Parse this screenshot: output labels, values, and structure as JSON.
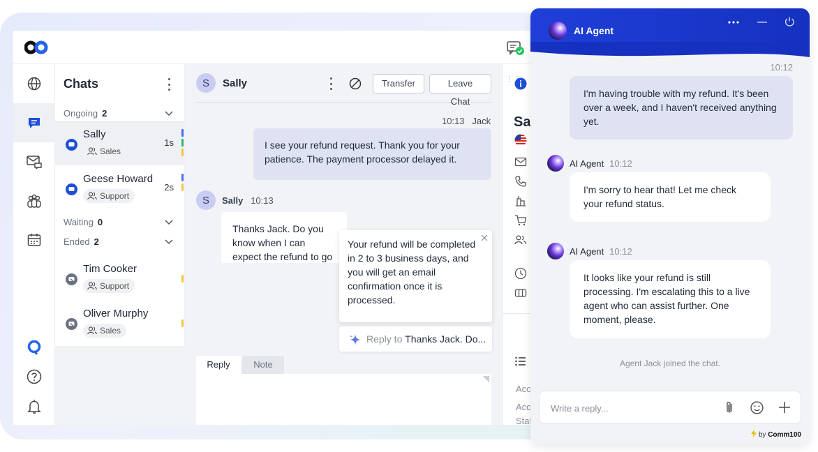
{
  "app": {
    "conversation": {
      "contact_name": "Sally",
      "contact_initial": "S",
      "transfer_label": "Transfer",
      "leave_label": "Leave Chat",
      "messages": [
        {
          "time": "10:13",
          "author": "Jack",
          "text": "I see your refund request. Thank you for your patience. The payment processor delayed it."
        },
        {
          "author": "Sally",
          "time": "10:13",
          "text": "Thanks Jack. Do you know when I can expect the refund to go th"
        }
      ],
      "suggestion": {
        "text": "Your refund will be completed in 2 to 3 business days, and you will get an email confirmation once it is processed.",
        "reply_prefix": "Reply to",
        "reply_quote": "Thanks Jack. Do..."
      },
      "tabs": [
        "Reply",
        "Note"
      ],
      "active_tab": "Reply"
    },
    "chats_panel": {
      "title": "Chats",
      "groups": {
        "ongoing": {
          "label": "Ongoing",
          "count": "2"
        },
        "waiting": {
          "label": "Waiting",
          "count": "0"
        },
        "ended": {
          "label": "Ended",
          "count": "2"
        }
      },
      "ongoing_items": [
        {
          "name": "Sally",
          "tag": "Sales",
          "time": "1s"
        },
        {
          "name": "Geese Howard",
          "tag": "Support",
          "time": "2s"
        }
      ],
      "ended_items": [
        {
          "name": "Tim Cooker",
          "tag": "Support"
        },
        {
          "name": "Oliver Murphy",
          "tag": "Sales"
        }
      ]
    },
    "info_panel": {
      "name_partial": "Sa",
      "labels": [
        "Acc",
        "Acc",
        "Stat"
      ]
    }
  },
  "ai_agent": {
    "title": "AI Agent",
    "messages": [
      {
        "role": "user",
        "time": "10:12",
        "text": "I'm having trouble with my refund. It's been over a week, and I haven't received anything yet."
      },
      {
        "role": "bot",
        "name": "AI Agent",
        "time": "10:12",
        "text": "I'm sorry to hear that! Let me check your refund status."
      },
      {
        "role": "bot",
        "name": "AI Agent",
        "time": "10:12",
        "text": "It looks like your refund is still processing. I'm escalating this to a live agent who can assist further. One moment, please."
      }
    ],
    "system_note": "Agent Jack joined the chat.",
    "input_placeholder": "Write a reply...",
    "powered_by_prefix": "by",
    "powered_by_brand": "Comm100"
  },
  "colors": {
    "brand_blue": "#1631c0",
    "agent_bubble": "#dfe2f3",
    "status_blue": "#4a6cf7",
    "status_green": "#2bb673",
    "status_yellow": "#f4c542"
  }
}
